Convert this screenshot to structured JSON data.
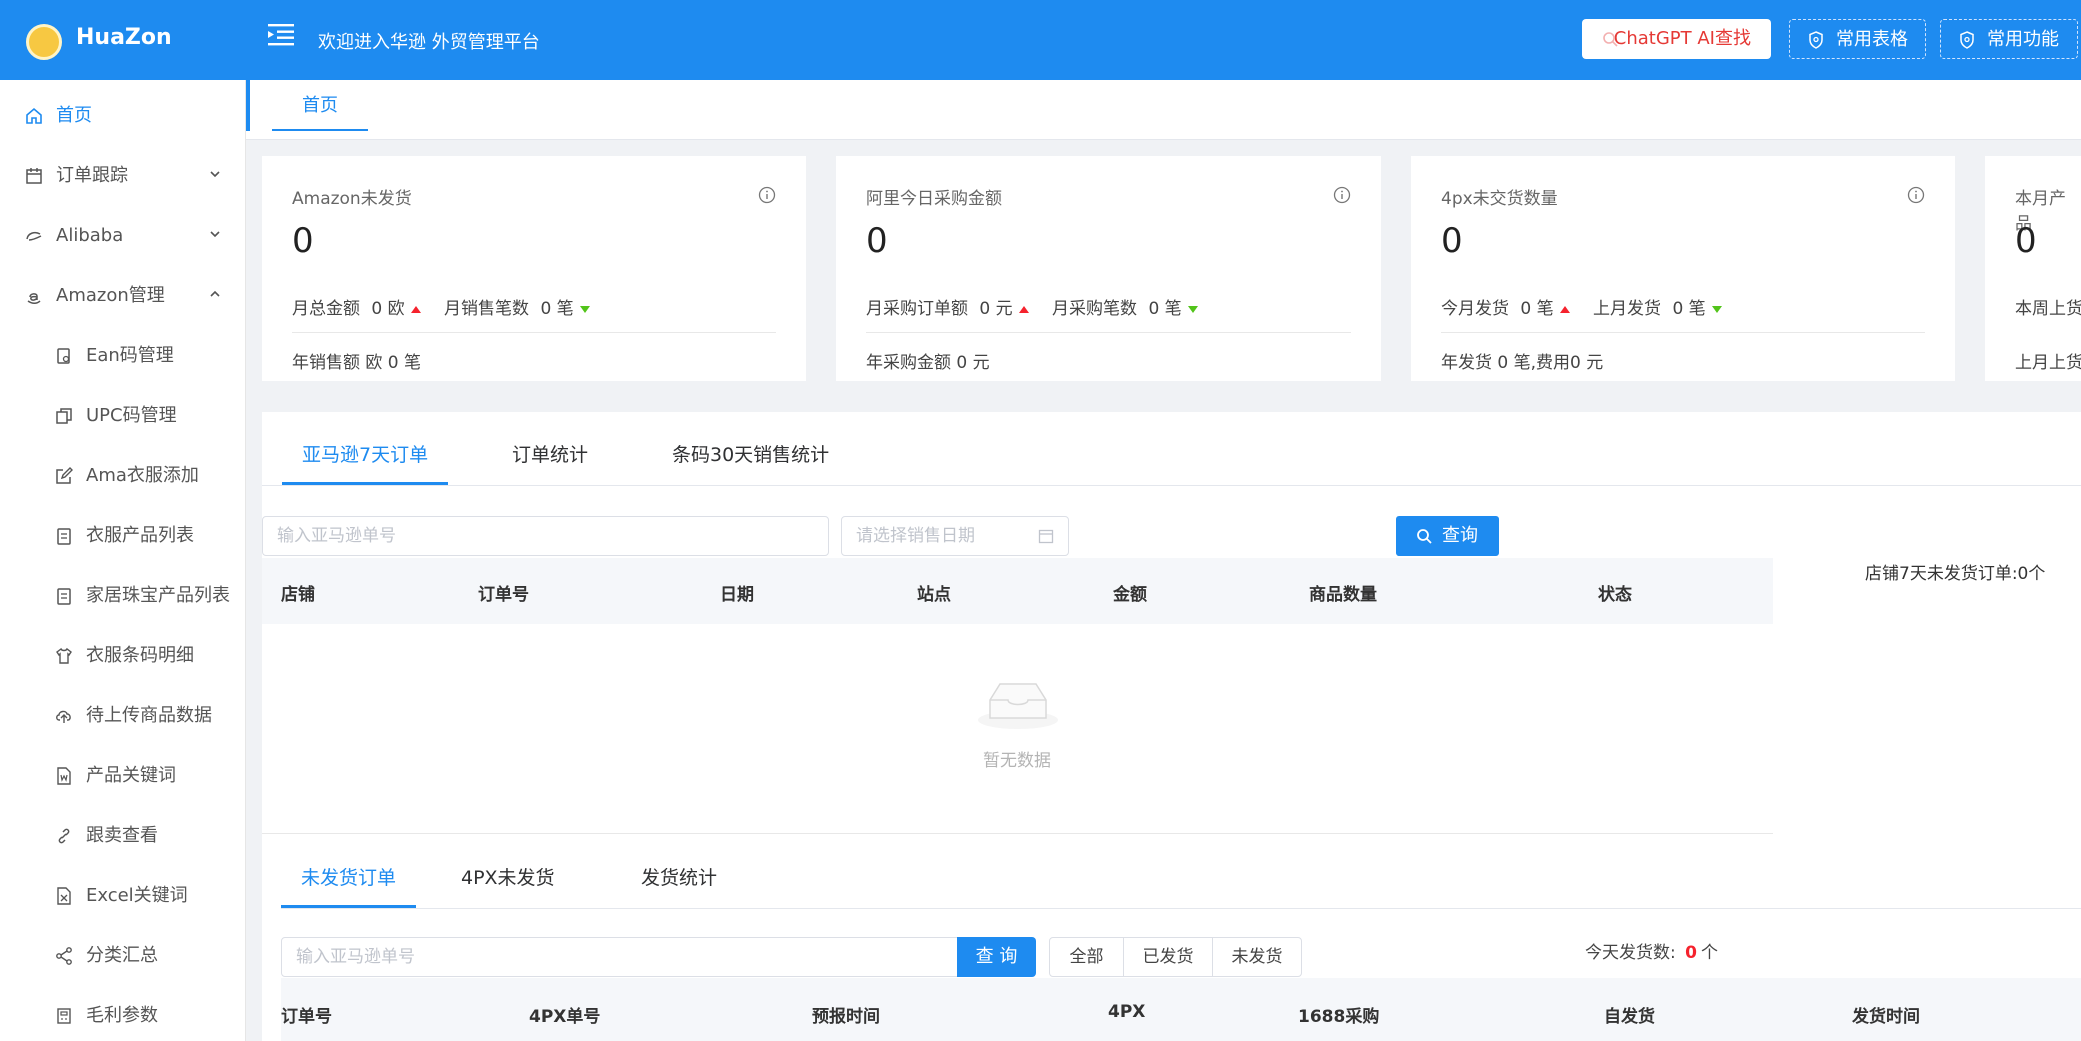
{
  "header": {
    "brand": "HuaZon",
    "welcome": "欢迎进入华逊 外贸管理平台",
    "gpt_button": "ChatGPT AI查找",
    "tables_button": "常用表格",
    "functions_button": "常用功能"
  },
  "sidebar": {
    "items": [
      {
        "label": "首页",
        "icon": "home-icon"
      },
      {
        "label": "订单跟踪",
        "icon": "calendar-icon"
      },
      {
        "label": "Alibaba",
        "icon": "alibaba-icon"
      },
      {
        "label": "Amazon管理",
        "icon": "amazon-icon"
      },
      {
        "label": "Ean码管理",
        "icon": "document-icon"
      },
      {
        "label": "UPC码管理",
        "icon": "copy-icon"
      },
      {
        "label": "Ama衣服添加",
        "icon": "edit-icon"
      },
      {
        "label": "衣服产品列表",
        "icon": "clipboard-icon"
      },
      {
        "label": "家居珠宝产品列表",
        "icon": "clipboard-icon"
      },
      {
        "label": "衣服条码明细",
        "icon": "shirt-icon"
      },
      {
        "label": "待上传商品数据",
        "icon": "upload-icon"
      },
      {
        "label": "产品关键词",
        "icon": "word-file-icon"
      },
      {
        "label": "跟卖查看",
        "icon": "link-icon"
      },
      {
        "label": "Excel关键词",
        "icon": "excel-file-icon"
      },
      {
        "label": "分类汇总",
        "icon": "share-icon"
      },
      {
        "label": "毛利参数",
        "icon": "calculator-icon"
      }
    ]
  },
  "tags": {
    "home": "首页"
  },
  "cards": [
    {
      "title": "Amazon未发货",
      "value": "0",
      "m1_label": "月总金额",
      "m1_value": "0 欧",
      "m2_label": "月销售笔数",
      "m2_value": "0 笔",
      "bottom": "年销售额 欧 0 笔"
    },
    {
      "title": "阿里今日采购金额",
      "value": "0",
      "m1_label": "月采购订单额",
      "m1_value": "0 元",
      "m2_label": "月采购笔数",
      "m2_value": "0 笔",
      "bottom": "年采购金额 0 元"
    },
    {
      "title": "4px未交货数量",
      "value": "0",
      "m1_label": "今月发货",
      "m1_value": "0 笔",
      "m2_label": "上月发货",
      "m2_value": "0 笔",
      "bottom": "年发货 0 笔,费用0 元"
    },
    {
      "title": "本月产品",
      "value": "0",
      "r1": "本周上货",
      "r2": "上月上货"
    }
  ],
  "orders": {
    "tabs": [
      "亚马逊7天订单",
      "订单统计",
      "条码30天销售统计"
    ],
    "order_input_placeholder": "输入亚马逊单号",
    "date_placeholder": "请选择销售日期",
    "query_button": "查询",
    "columns": [
      "店铺",
      "订单号",
      "日期",
      "站点",
      "金额",
      "商品数量",
      "状态"
    ],
    "empty_text": "暂无数据",
    "side_info": "店铺7天未发货订单:0个"
  },
  "shipping": {
    "tabs": [
      "未发货订单",
      "4PX未发货",
      "发货统计"
    ],
    "input_placeholder": "输入亚马逊单号",
    "query_button": "查 询",
    "filters": [
      "全部",
      "已发货",
      "未发货"
    ],
    "today_label": "今天发货数:",
    "today_count": "0",
    "today_unit": "个",
    "columns": [
      "订单号",
      "4PX单号",
      "预报时间",
      "4PX",
      "1688采购",
      "自发货",
      "发货时间"
    ]
  }
}
